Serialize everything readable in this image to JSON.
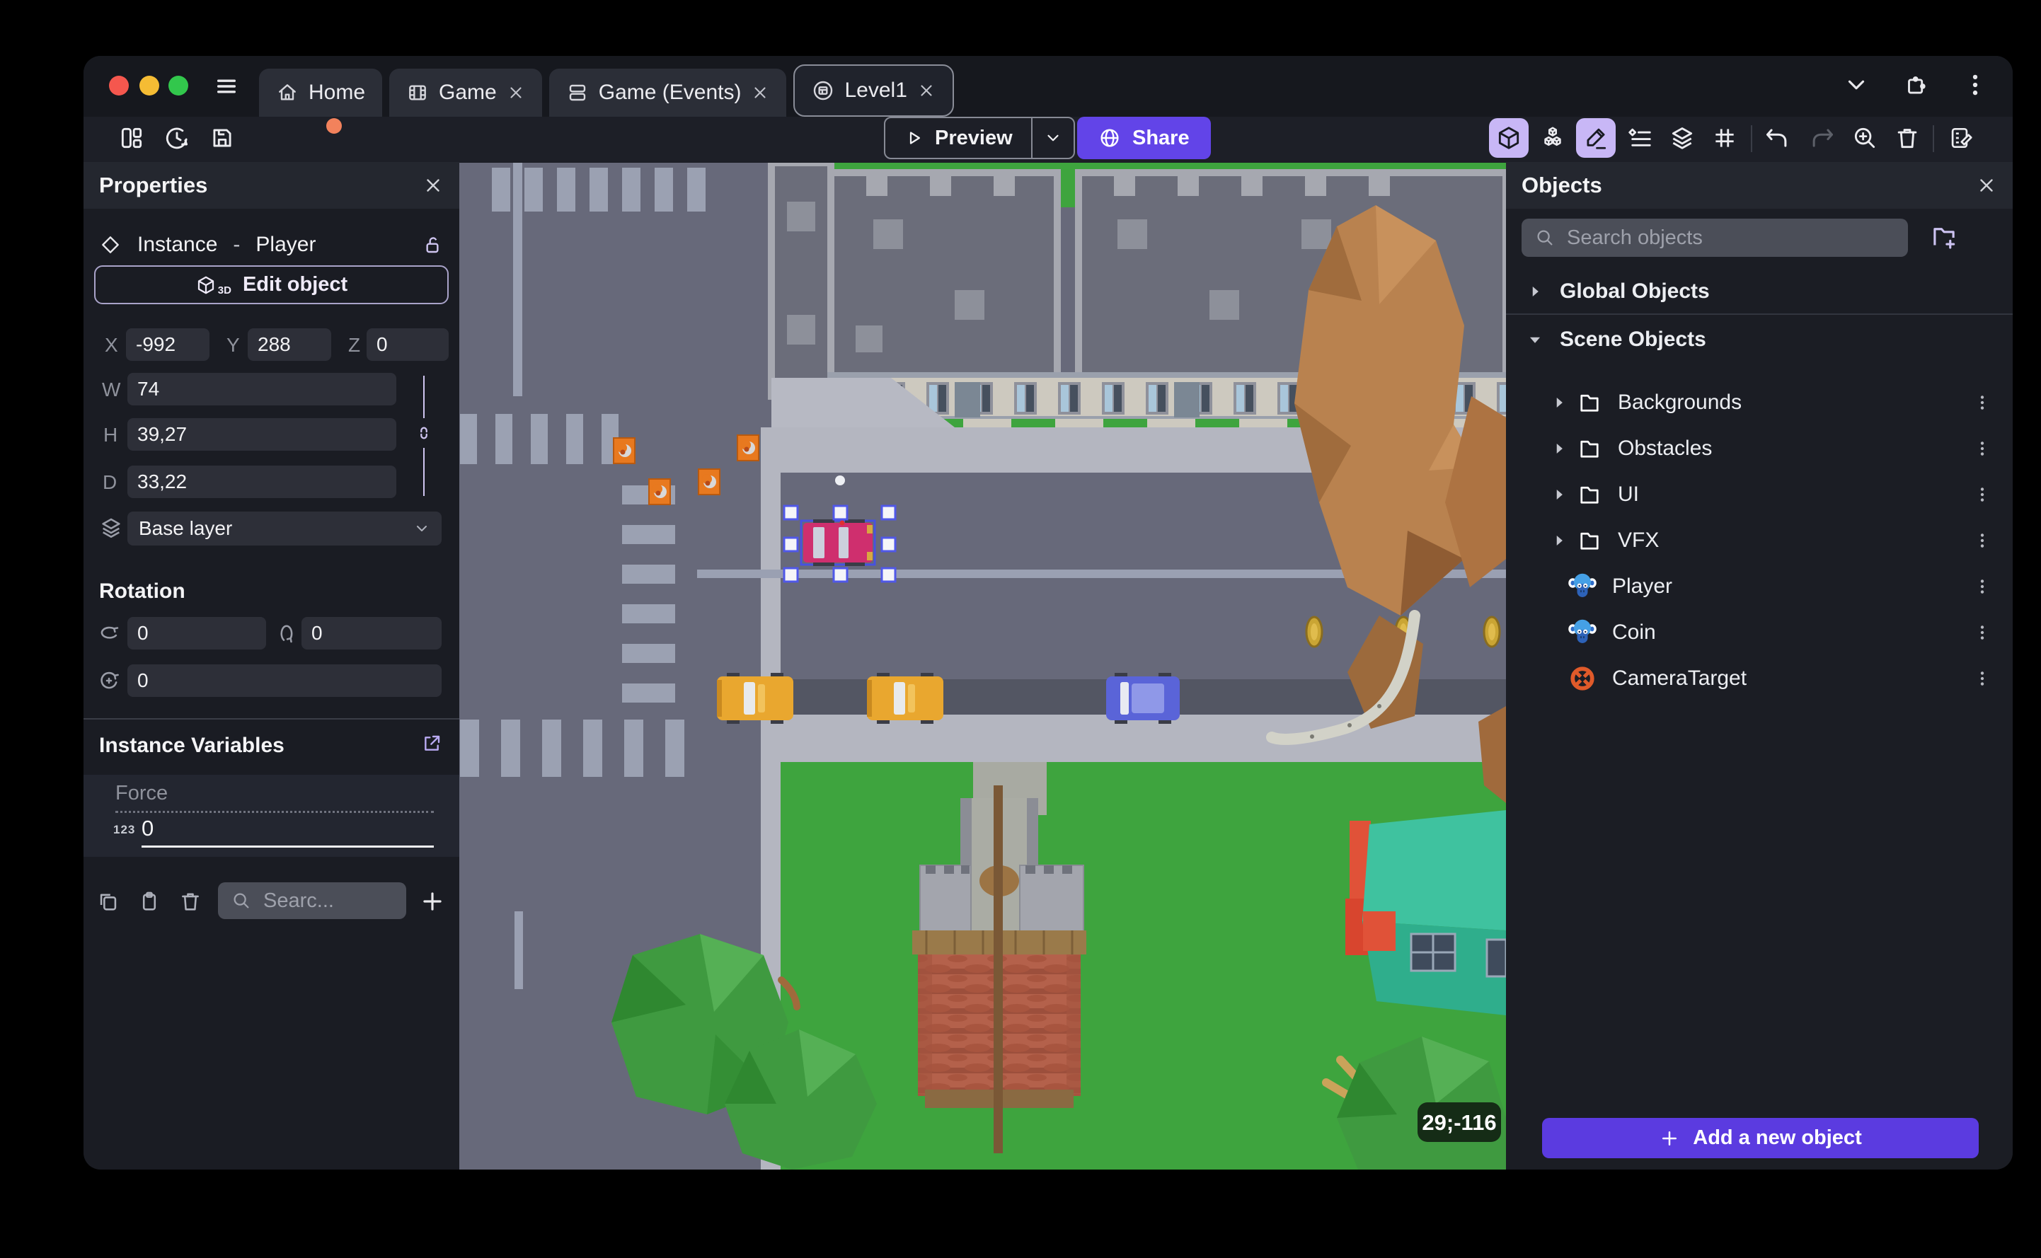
{
  "titlebar": {
    "tabs": [
      {
        "label": "Home",
        "icon": "home-icon"
      },
      {
        "label": "Game",
        "icon": "film-icon"
      },
      {
        "label": "Game (Events)",
        "icon": "events-icon"
      },
      {
        "label": "Level1",
        "icon": "scene-icon"
      }
    ]
  },
  "toolbar": {
    "preview_label": "Preview",
    "share_label": "Share"
  },
  "properties": {
    "title": "Properties",
    "instance_label": "Instance",
    "separator": "-",
    "object_name": "Player",
    "edit_object_label": "Edit object",
    "edit_object_badge": "3D",
    "position": {
      "x_label": "X",
      "x": "-992",
      "y_label": "Y",
      "y": "288",
      "z_label": "Z",
      "z": "0"
    },
    "size": {
      "w_label": "W",
      "w": "74",
      "h_label": "H",
      "h": "39,27",
      "d_label": "D",
      "d": "33,22"
    },
    "layer_value": "Base layer",
    "rotation_title": "Rotation",
    "rotation": {
      "x": "0",
      "y": "0",
      "z": "0"
    },
    "variables_title": "Instance Variables",
    "variables": [
      {
        "name": "Force",
        "type_badge": "123",
        "value": "0"
      }
    ],
    "search_placeholder": "Searc..."
  },
  "objects_panel": {
    "title": "Objects",
    "search_placeholder": "Search objects",
    "global_section": "Global Objects",
    "scene_section": "Scene Objects",
    "folders": [
      {
        "label": "Backgrounds"
      },
      {
        "label": "Obstacles"
      },
      {
        "label": "UI"
      },
      {
        "label": "VFX"
      }
    ],
    "objects": [
      {
        "label": "Player",
        "icon": "monkey-icon"
      },
      {
        "label": "Coin",
        "icon": "monkey-icon"
      },
      {
        "label": "CameraTarget",
        "icon": "target-icon"
      }
    ],
    "add_button_label": "Add a new object"
  },
  "canvas": {
    "coords_badge": "29;-116"
  },
  "colors": {
    "accent_purple": "#6244e8",
    "add_button_purple": "#5b3be0",
    "active_icon_bg": "#c8b7f6",
    "unsaved_dot": "#f2825c",
    "selection_blue": "#4752e0"
  }
}
